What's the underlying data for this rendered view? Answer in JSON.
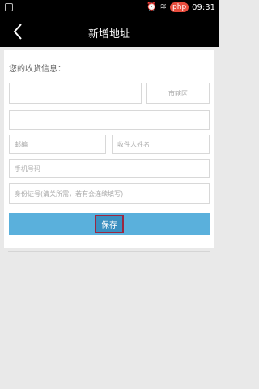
{
  "status_bar": {
    "php_badge": "php",
    "time": "09:31",
    "icons": [
      "alarm-icon",
      "wifi-icon",
      "battery-icon"
    ]
  },
  "nav": {
    "title": "新增地址"
  },
  "form": {
    "section_label": "您的收货信息：",
    "fields": {
      "district": "市辖区",
      "detail": "........",
      "postcode": "邮编",
      "receiver": "收件人姓名",
      "phone": "手机号码",
      "note": "身份证号(清关所需，若有会连续填写)"
    },
    "submit_label": "保存"
  },
  "colors": {
    "accent": "#5ab0dc",
    "highlight_border": "#9b2741"
  }
}
